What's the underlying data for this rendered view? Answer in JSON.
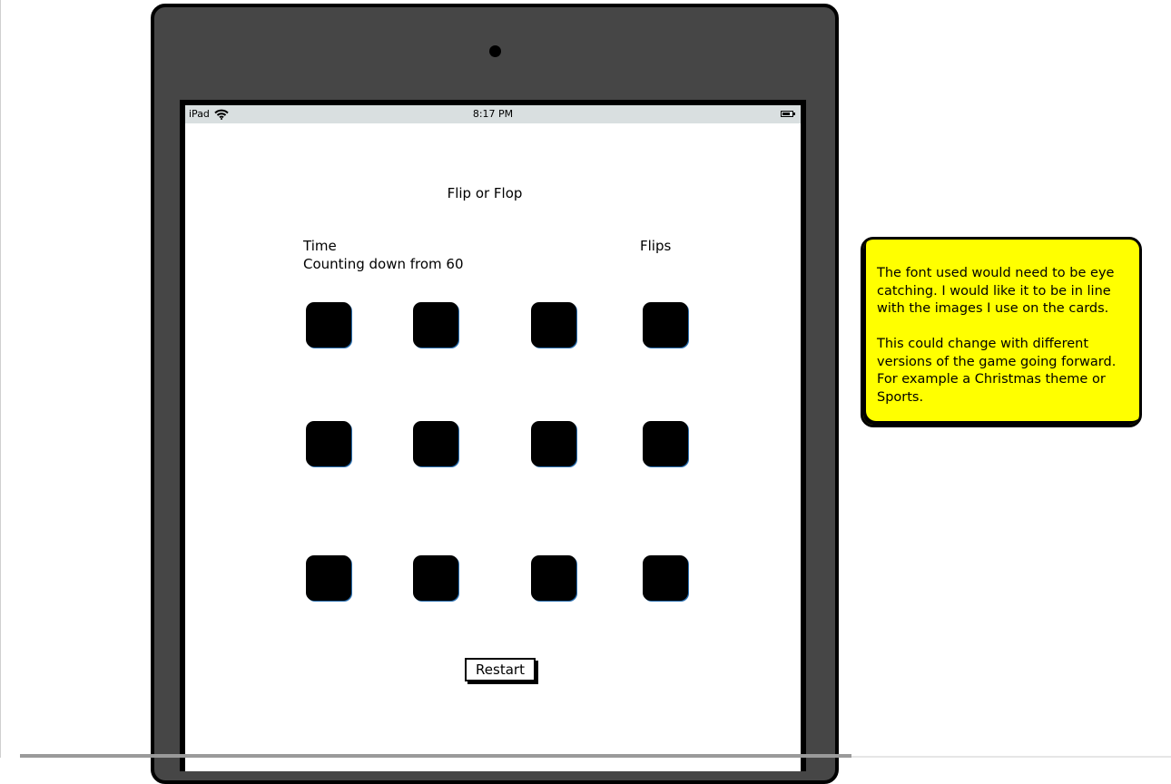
{
  "status_bar": {
    "carrier": "iPad",
    "time": "8:17 PM",
    "wifi_icon": "wifi-icon",
    "battery_icon": "battery-icon"
  },
  "game": {
    "title": "Flip or Flop",
    "time_label": "Time",
    "countdown_text": "Counting down from 60",
    "flips_label": "Flips",
    "card_rows": 3,
    "card_columns": 4,
    "restart_label": "Restart"
  },
  "note": {
    "paragraph_1": "The font used would need to be eye catching. I would like it to be in line with the images I use on the cards.",
    "paragraph_2": "This could change with different versions of the game going forward. For example a Christmas theme or Sports.",
    "background_color": "#ffff00"
  },
  "colors": {
    "device_frame": "#464646",
    "status_bar": "#d9dfe0",
    "card": "#000000"
  }
}
